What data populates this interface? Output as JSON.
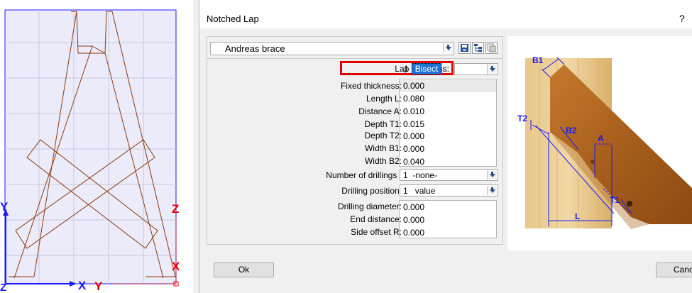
{
  "cad": {
    "axes": {
      "y": "Y",
      "x": "X",
      "z": "Z",
      "y2": "Y",
      "z2": "Z",
      "x2": "X"
    },
    "colors": {
      "background": "#ebebfa",
      "grid": "#c9c9dc",
      "beam": "#8b3a0f",
      "axis_blue": "#1a1aff",
      "axis_red": "#e80000"
    }
  },
  "dialog": {
    "title": "Notched Lap",
    "help": "?",
    "preset": {
      "value": "Andreas brace"
    },
    "toolbar": {
      "save": "save-icon",
      "tree": "tree-icon",
      "copy": "copy-icon"
    },
    "lap_thickness": {
      "label": "Lap thickness:",
      "index": "1",
      "value": "Bisect"
    },
    "params": [
      {
        "label": "Fixed thickness:",
        "value": "0.000"
      },
      {
        "label": "Length L:",
        "value": "0.080"
      },
      {
        "label": "Distance A:",
        "value": "0.010"
      },
      {
        "label": "Depth T1:",
        "value": "0.015"
      },
      {
        "label": "Depth T2:",
        "value": "0.000"
      },
      {
        "label": "Width B1:",
        "value": "0.000"
      },
      {
        "label": "Width B2:",
        "value": "0.040"
      }
    ],
    "drillings": {
      "label": "Number of drillings :",
      "index": "1",
      "value": "-none-"
    },
    "drilling_position": {
      "label": "Drilling position:",
      "index": "1",
      "value": "value"
    },
    "drill_params": [
      {
        "label": "Drilling diameter:",
        "value": "0.000"
      },
      {
        "label": "End distance:",
        "value": "0.000"
      },
      {
        "label": "Side offset R:",
        "value": "0.000"
      }
    ],
    "preview": {
      "B1": "B1",
      "T2": "T2",
      "B2": "B2",
      "A": "A",
      "T1": "T1",
      "L": "L"
    },
    "ok_label": "Ok",
    "cancel_label": "Cancel"
  }
}
